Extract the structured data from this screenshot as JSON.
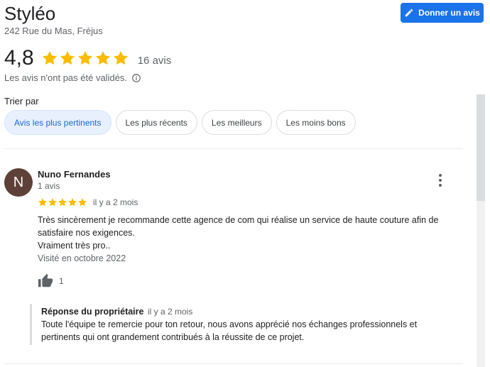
{
  "business": {
    "name": "Styléo",
    "address": "242 Rue du Mas, Fréjus"
  },
  "review_button": {
    "label": "Donner un avis",
    "icon": "pencil-icon",
    "color": "#1a73e8"
  },
  "summary": {
    "rating": "4,8",
    "stars": 5,
    "count": "16 avis",
    "notice": "Les avis n'ont pas été validés.",
    "star_color": "#fbbc04"
  },
  "sort": {
    "label": "Trier par",
    "options": [
      {
        "label": "Avis les plus pertinents",
        "active": true
      },
      {
        "label": "Les plus récents",
        "active": false
      },
      {
        "label": "Les meilleurs",
        "active": false
      },
      {
        "label": "Les moins bons",
        "active": false
      }
    ]
  },
  "review": {
    "avatar_letter": "N",
    "avatar_color": "#5d4037",
    "author": "Nuno Fernandes",
    "author_meta": "1 avis",
    "stars": 5,
    "date": "il y a 2 mois",
    "text_line1": "Très sincèrement je recommande cette agence de com qui réalise un service de haute couture afin de",
    "text_line2": "satisfaire nos exigences.",
    "text_line3": "Vraiment très pro..",
    "visit": "Visité en octobre 2022",
    "likes": "1"
  },
  "owner_reply": {
    "title": "Réponse du propriétaire",
    "date": "il y a 2 mois",
    "text_line1": "Toute l'équipe te remercie pour ton retour, nous avons apprécié nos échanges professionnels et",
    "text_line2": "pertinents qui ont grandement contribués à la réussite de ce projet."
  }
}
